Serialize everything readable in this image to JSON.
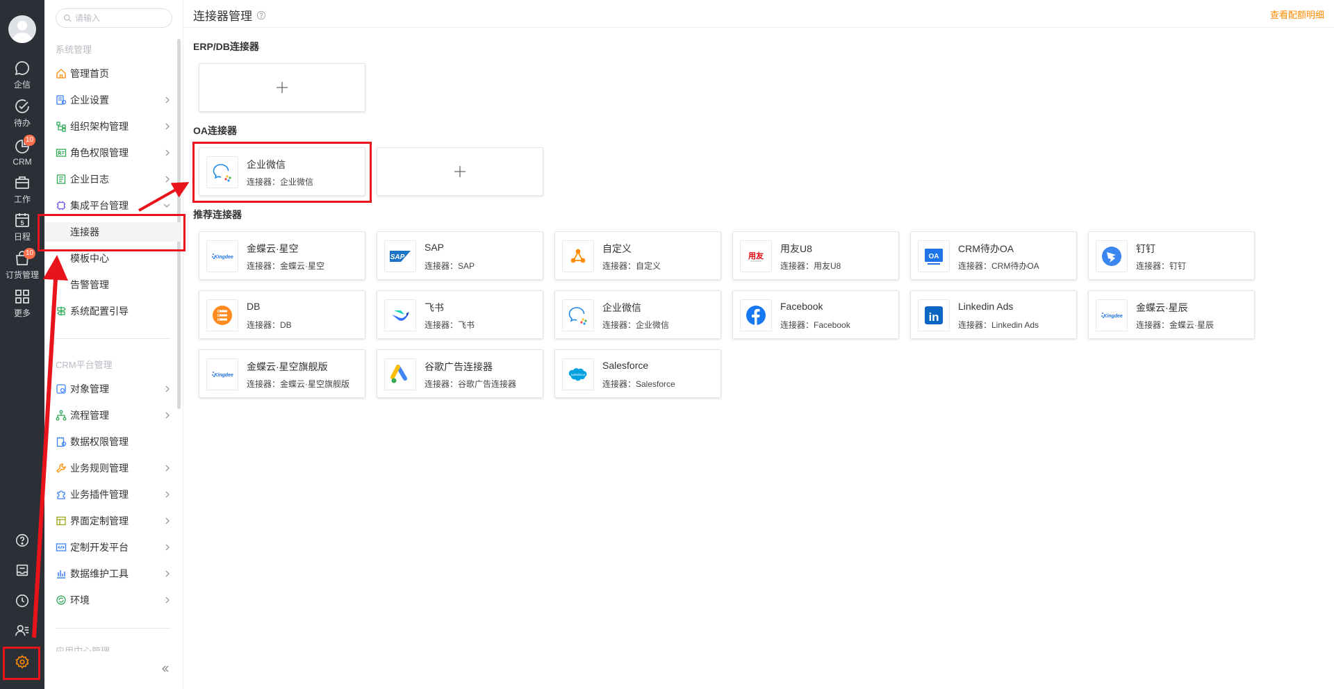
{
  "rail": {
    "items": [
      {
        "label": "企信",
        "icon": "chat-bubble-icon"
      },
      {
        "label": "待办",
        "icon": "check-circle-icon"
      },
      {
        "label": "CRM",
        "icon": "pie-chart-icon",
        "badge": "10"
      },
      {
        "label": "工作",
        "icon": "briefcase-icon"
      },
      {
        "label": "日程",
        "icon": "calendar-icon",
        "date": "5"
      },
      {
        "label": "订货管理",
        "icon": "shopping-bag-icon",
        "badge": "10"
      },
      {
        "label": "更多",
        "icon": "grid-icon"
      }
    ],
    "bottom": [
      "help-icon",
      "inbox-icon",
      "clock-icon",
      "contacts-icon",
      "settings-icon"
    ]
  },
  "nav": {
    "search_placeholder": "请输入",
    "group1": "系统管理",
    "items1": [
      {
        "label": "管理首页"
      },
      {
        "label": "企业设置"
      },
      {
        "label": "组织架构管理"
      },
      {
        "label": "角色权限管理"
      },
      {
        "label": "企业日志"
      },
      {
        "label": "集成平台管理"
      }
    ],
    "sub_items": [
      "连接器",
      "模板中心",
      "告警管理"
    ],
    "item_after": "系统配置引导",
    "group2": "CRM平台管理",
    "items2": [
      {
        "label": "对象管理"
      },
      {
        "label": "流程管理"
      },
      {
        "label": "数据权限管理"
      },
      {
        "label": "业务规则管理"
      },
      {
        "label": "业务插件管理"
      },
      {
        "label": "界面定制管理"
      },
      {
        "label": "定制开发平台"
      },
      {
        "label": "数据维护工具"
      },
      {
        "label": "环境"
      }
    ],
    "group3": "应用中心管理"
  },
  "header": {
    "title": "连接器管理",
    "quota_link": "查看配额明细"
  },
  "sections": {
    "erp": "ERP/DB连接器",
    "oa": "OA连接器",
    "recommended": "推荐连接器"
  },
  "oa_cards": [
    {
      "name": "企业微信",
      "sub": "连接器：企业微信",
      "icon": "wecom-icon"
    }
  ],
  "recommended_cards": [
    {
      "name": "金蝶云·星空",
      "sub": "连接器：金蝶云·星空",
      "icon": "kingdee-logo-icon",
      "logo_text": "Kingdee"
    },
    {
      "name": "SAP",
      "sub": "连接器：SAP",
      "icon": "sap-logo-icon",
      "logo_text": "SAP"
    },
    {
      "name": "自定义",
      "sub": "连接器：自定义",
      "icon": "custom-nodes-icon"
    },
    {
      "name": "用友U8",
      "sub": "连接器：用友U8",
      "icon": "yonyou-logo-icon",
      "logo_text": "用友"
    },
    {
      "name": "CRM待办OA",
      "sub": "连接器：CRM待办OA",
      "icon": "oa-logo-icon",
      "logo_text": "OA"
    },
    {
      "name": "钉钉",
      "sub": "连接器：钉钉",
      "icon": "dingtalk-icon"
    },
    {
      "name": "DB",
      "sub": "连接器：DB",
      "icon": "database-icon"
    },
    {
      "name": "飞书",
      "sub": "连接器：飞书",
      "icon": "feishu-icon"
    },
    {
      "name": "企业微信",
      "sub": "连接器：企业微信",
      "icon": "wecom-icon"
    },
    {
      "name": "Facebook",
      "sub": "连接器：Facebook",
      "icon": "facebook-icon"
    },
    {
      "name": "Linkedin Ads",
      "sub": "连接器：Linkedin Ads",
      "icon": "linkedin-icon",
      "logo_text": "in"
    },
    {
      "name": "金蝶云·星辰",
      "sub": "连接器：金蝶云·星辰",
      "icon": "kingdee-logo-icon",
      "logo_text": "Kingdee"
    },
    {
      "name": "金蝶云·星空旗舰版",
      "sub": "连接器：金蝶云·星空旗舰版",
      "icon": "kingdee-logo-icon",
      "logo_text": "Kingdee"
    },
    {
      "name": "谷歌广告连接器",
      "sub": "连接器：谷歌广告连接器",
      "icon": "google-ads-icon"
    },
    {
      "name": "Salesforce",
      "sub": "连接器：Salesforce",
      "icon": "salesforce-icon",
      "logo_text": "salesforce"
    }
  ],
  "colors": {
    "rail_bg": "#2b2f36",
    "accent": "#ff8a00",
    "highlight": "#e8131b",
    "badge": "#ff6f4b"
  }
}
